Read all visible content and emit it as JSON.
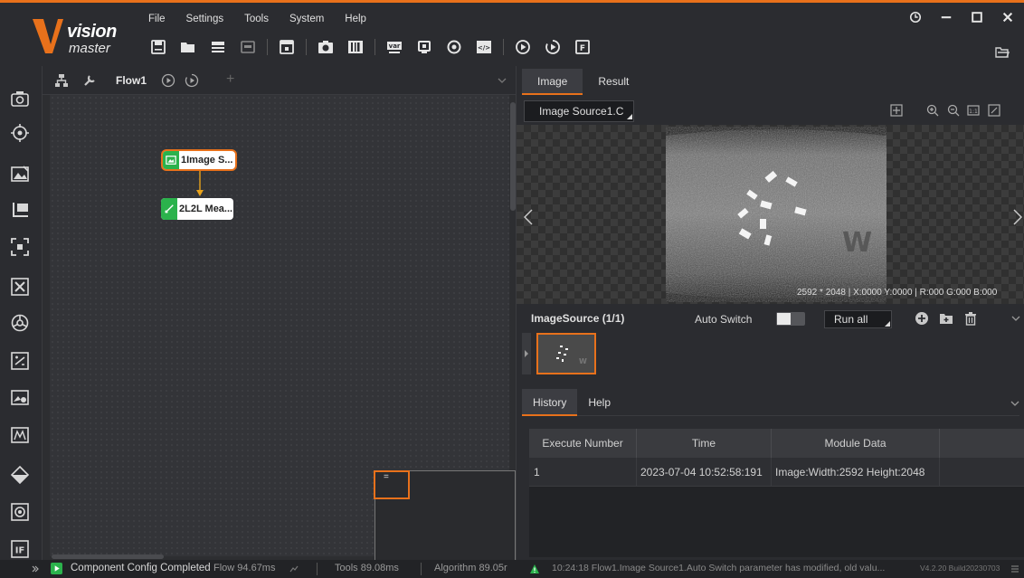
{
  "app": {
    "logo_text": "vision",
    "logo_sub": "master"
  },
  "menu": [
    "File",
    "Settings",
    "Tools",
    "System",
    "Help"
  ],
  "toolbar": [
    "save-icon",
    "open-folder-icon",
    "undo-icon",
    "redo-icon",
    "calculator-icon",
    "camera-icon",
    "barcode-icon",
    "variable-icon",
    "communication-icon",
    "global-icon",
    "script-icon",
    "run-once-icon",
    "run-loop-icon",
    "file-icon"
  ],
  "flow": {
    "tab_label": "Flow1",
    "add_label": "+",
    "nodes": [
      {
        "label": "1Image S...",
        "icon": "image-source-icon"
      },
      {
        "label": "2L2L Mea...",
        "icon": "measure-icon"
      }
    ],
    "minimap_marker": "="
  },
  "status": {
    "message": "Component Config Completed",
    "flow": "Flow 94.67ms",
    "tools": "Tools 89.08ms",
    "algorithm": "Algorithm 89.05r",
    "log": "10:24:18  Flow1.Image Source1.Auto Switch parameter has modified, old valu...",
    "version": "V4.2.20 Build20230703"
  },
  "right": {
    "tabs": [
      "Image",
      "Result"
    ],
    "source_select": "Image Source1.C",
    "pixel_info": "2592 * 2048   |  X:0000  Y:0000  |  R:000  G:000  B:000",
    "image_source_label": "ImageSource (1/1)",
    "auto_switch_label": "Auto Switch",
    "run_mode": "Run all"
  },
  "history": {
    "tabs": [
      "History",
      "Help"
    ],
    "columns": [
      "Execute Number",
      "Time",
      "Module Data"
    ],
    "rows": [
      {
        "num": "1",
        "time": "2023-07-04 10:52:58:191",
        "data": "Image:Width:2592 Height:2048"
      }
    ]
  },
  "colors": {
    "accent": "#e8711b",
    "node_green": "#2bb24c"
  }
}
